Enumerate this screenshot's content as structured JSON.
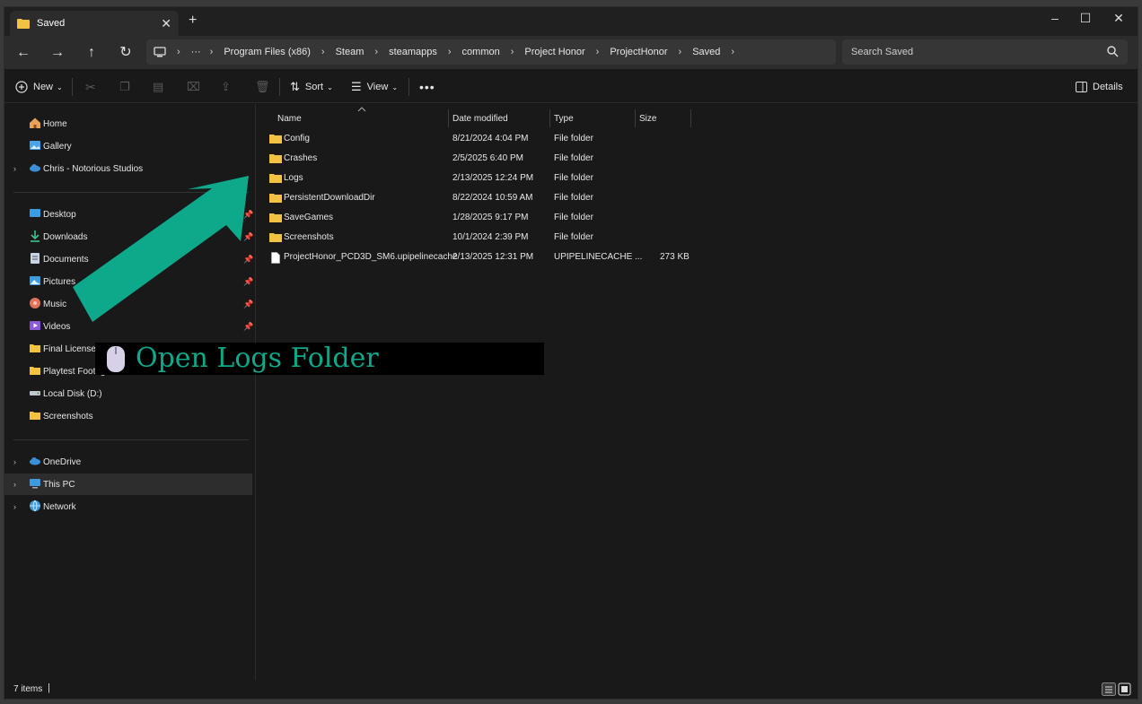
{
  "window": {
    "tab_title": "Saved",
    "tab_icon": "folder-icon"
  },
  "breadcrumb": [
    "Program Files (x86)",
    "Steam",
    "steamapps",
    "common",
    "Project Honor",
    "ProjectHonor",
    "Saved"
  ],
  "search": {
    "placeholder": "Search Saved"
  },
  "toolbar": {
    "new_label": "New",
    "sort_label": "Sort",
    "view_label": "View",
    "details_label": "Details"
  },
  "sidebar": {
    "items": [
      {
        "label": "Home",
        "icon": "home-icon"
      },
      {
        "label": "Gallery",
        "icon": "gallery-icon"
      },
      {
        "label": "Chris - Notorious Studios",
        "icon": "cloud-icon"
      },
      {
        "label": "Desktop",
        "icon": "desktop-icon"
      },
      {
        "label": "Downloads",
        "icon": "download-icon"
      },
      {
        "label": "Documents",
        "icon": "documents-icon"
      },
      {
        "label": "Pictures",
        "icon": "pictures-icon"
      },
      {
        "label": "Music",
        "icon": "music-icon"
      },
      {
        "label": "Videos",
        "icon": "videos-icon"
      },
      {
        "label": "Final License",
        "icon": "folder-icon"
      },
      {
        "label": "Playtest Footage",
        "icon": "folder-icon"
      },
      {
        "label": "Local Disk (D:)",
        "icon": "drive-icon"
      },
      {
        "label": "Screenshots",
        "icon": "folder-icon"
      },
      {
        "label": "OneDrive",
        "icon": "cloud-icon"
      },
      {
        "label": "This PC",
        "icon": "pc-icon"
      },
      {
        "label": "Network",
        "icon": "network-icon"
      }
    ]
  },
  "columns": [
    "Name",
    "Date modified",
    "Type",
    "Size"
  ],
  "files": [
    {
      "name": "Config",
      "date": "8/21/2024 4:04 PM",
      "type": "File folder",
      "size": ""
    },
    {
      "name": "Crashes",
      "date": "2/5/2025 6:40 PM",
      "type": "File folder",
      "size": ""
    },
    {
      "name": "Logs",
      "date": "2/13/2025 12:24 PM",
      "type": "File folder",
      "size": ""
    },
    {
      "name": "PersistentDownloadDir",
      "date": "8/22/2024 10:59 AM",
      "type": "File folder",
      "size": ""
    },
    {
      "name": "SaveGames",
      "date": "1/28/2025 9:17 PM",
      "type": "File folder",
      "size": ""
    },
    {
      "name": "Screenshots",
      "date": "10/1/2024 2:39 PM",
      "type": "File folder",
      "size": ""
    },
    {
      "name": "ProjectHonor_PCD3D_SM6.upipelinecache",
      "date": "2/13/2025 12:31 PM",
      "type": "UPIPELINECACHE ...",
      "size": "273 KB"
    }
  ],
  "status": {
    "item_count": "7 items"
  },
  "overlay": {
    "text": "Open Logs Folder",
    "color": "#0ea88a"
  },
  "colors": {
    "folder": "#f4c242",
    "accent": "#0ea88a"
  }
}
